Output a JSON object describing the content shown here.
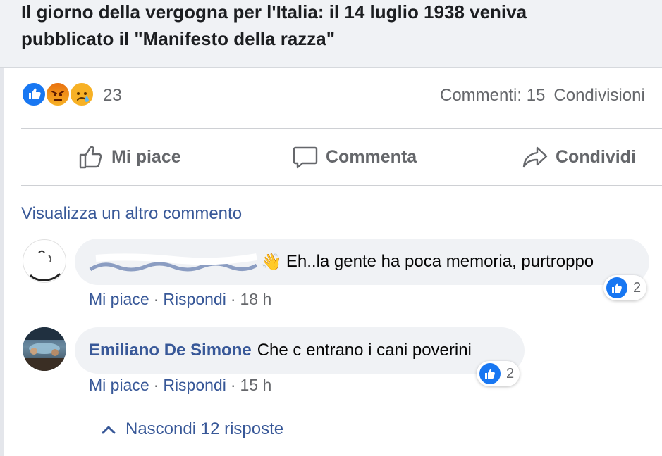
{
  "post": {
    "title_line1": "Il giorno della vergogna per l'Italia: il 14 luglio 1938 veniva",
    "title_line2": "pubblicato il \"Manifesto della razza\""
  },
  "reactions": {
    "icons": [
      "like-icon",
      "angry-icon",
      "sad-icon"
    ],
    "count": "23",
    "comments": "Commenti: 15",
    "shares": "Condivisioni"
  },
  "actions": {
    "like": "Mi piace",
    "comment": "Commenta",
    "share": "Condividi"
  },
  "comments_section": {
    "view_more": "Visualizza un altro commento",
    "items": [
      {
        "author_obscured": true,
        "emoji": "👋",
        "text": "Eh..la gente ha poca memoria, purtroppo",
        "like_label": "Mi piace",
        "reply_label": "Rispondi",
        "time": "18 h",
        "like_count": "2"
      },
      {
        "author": "Emiliano De Simone",
        "text": "Che c entrano i cani poverini",
        "like_label": "Mi piace",
        "reply_label": "Rispondi",
        "time": "15 h",
        "like_count": "2"
      }
    ],
    "hide_replies": "Nascondi 12 risposte"
  },
  "colors": {
    "link": "#385898",
    "secondary_text": "#65676b",
    "like_blue": "#1877f2",
    "bubble_bg": "#f0f2f5"
  }
}
